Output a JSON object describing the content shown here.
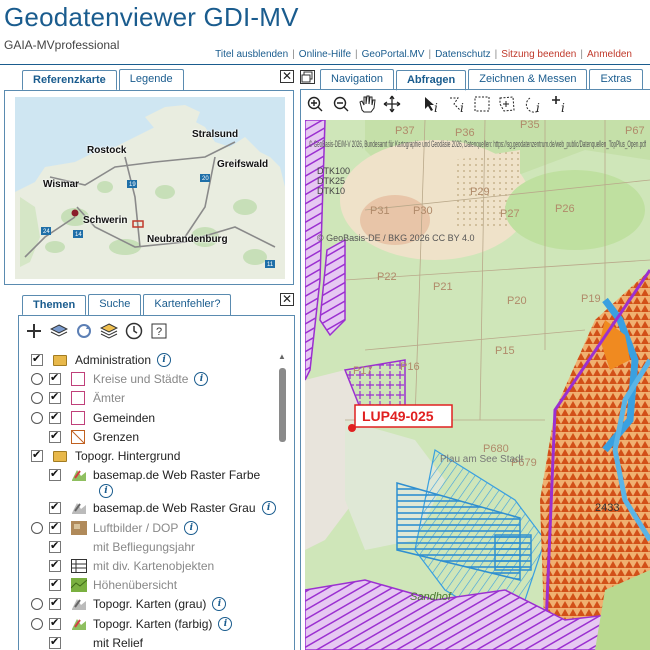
{
  "header": {
    "title": "Geodatenviewer GDI-MV",
    "subtitle": "GAIA-MVprofessional",
    "links": [
      {
        "label": "Titel ausblenden",
        "red": false
      },
      {
        "label": "Online-Hilfe",
        "red": false
      },
      {
        "label": "GeoPortal.MV",
        "red": false
      },
      {
        "label": "Datenschutz",
        "red": false
      },
      {
        "label": "Sitzung beenden",
        "red": true
      },
      {
        "label": "Anmelden",
        "red": true
      }
    ]
  },
  "ref_panel": {
    "tabs": [
      "Referenzkarte",
      "Legende"
    ],
    "cities": [
      "Stralsund",
      "Rostock",
      "Greifswald",
      "Wismar",
      "Schwerin",
      "Neubrandenburg"
    ],
    "road_labels": [
      "19",
      "20",
      "24",
      "14",
      "11"
    ]
  },
  "themes_panel": {
    "tabs": [
      "Themen",
      "Suche",
      "Kartenfehler?"
    ],
    "tree": [
      {
        "label": "Administration",
        "control": "checkbox-on",
        "icon": "folder",
        "info": true,
        "indent": 0,
        "grey": false
      },
      {
        "label": "Kreise und Städte",
        "control": "radio",
        "icon": "swatch",
        "info": true,
        "indent": 1,
        "grey": true
      },
      {
        "label": "Ämter",
        "control": "radio",
        "icon": "swatch",
        "info": false,
        "indent": 1,
        "grey": true
      },
      {
        "label": "Gemeinden",
        "control": "radio",
        "icon": "swatch",
        "info": false,
        "indent": 1,
        "grey": false
      },
      {
        "label": "Grenzen",
        "control": "checkbox-on",
        "icon": "grenze",
        "info": false,
        "indent": 1,
        "grey": false
      },
      {
        "label": "Topogr. Hintergrund",
        "control": "checkbox-on",
        "icon": "folder",
        "info": false,
        "indent": 0,
        "grey": false
      },
      {
        "label": "basemap.de Web Raster Farbe",
        "control": "checkbox-on",
        "icon": "layer-color",
        "info": true,
        "indent": 1,
        "grey": false
      },
      {
        "label": "basemap.de Web Raster Grau",
        "control": "checkbox-on",
        "icon": "layer-grey",
        "info": true,
        "indent": 1,
        "grey": false
      },
      {
        "label": "Luftbilder / DOP",
        "control": "radio-chk",
        "icon": "photo",
        "info": true,
        "indent": 1,
        "grey": true
      },
      {
        "label": "mit Befliegungsjahr",
        "control": "checkbox-on",
        "icon": "none",
        "info": false,
        "indent": 1,
        "grey": true
      },
      {
        "label": "mit div. Kartenobjekten",
        "control": "checkbox-on",
        "icon": "grid",
        "info": false,
        "indent": 1,
        "grey": true
      },
      {
        "label": "Höhenübersicht",
        "control": "checkbox-on",
        "icon": "relief",
        "info": false,
        "indent": 1,
        "grey": true
      },
      {
        "label": "Topogr. Karten (grau)",
        "control": "radio-chk",
        "icon": "layer-grey",
        "info": true,
        "indent": 1,
        "grey": false
      },
      {
        "label": "Topogr. Karten (farbig)",
        "control": "radio-chk",
        "icon": "layer-color",
        "info": true,
        "indent": 1,
        "grey": false
      },
      {
        "label": "mit Relief",
        "control": "checkbox-on",
        "icon": "none",
        "info": false,
        "indent": 1,
        "grey": false
      }
    ]
  },
  "map_panel": {
    "tabs": [
      "Navigation",
      "Abfragen",
      "Zeichnen & Messen",
      "Extras"
    ],
    "active_tab": "Abfragen",
    "copyright": "© GeoBasis-DE/M-V 2026, Bundesamt für Kartographie und Geodäsie 2026, Datenquellen: https://sg.geodatenzentrum.de/web_public/Datenquellen_TopPlus_Open.pdf",
    "copyright2": "© GeoBasis-DE / BKG 2026 CC BY 4.0",
    "dtk_labels": [
      "DTK100",
      "DTK25",
      "DTK10"
    ],
    "parcel_labels": [
      "P37",
      "P36",
      "P35",
      "P67",
      "P29",
      "P31",
      "P30",
      "P27",
      "P26",
      "P22",
      "P21",
      "P20",
      "P19",
      "P17",
      "P16",
      "P15",
      "P680",
      "P679"
    ],
    "feature_label": "LUP49-025",
    "place_labels": [
      "Plau am See Stadt",
      "Sandhof"
    ],
    "number_label": "2433",
    "colors": {
      "accent": "#1a5c8e",
      "hatch": "#9b30d0",
      "marker": "#e02020",
      "water": "#3aa0e0"
    }
  }
}
